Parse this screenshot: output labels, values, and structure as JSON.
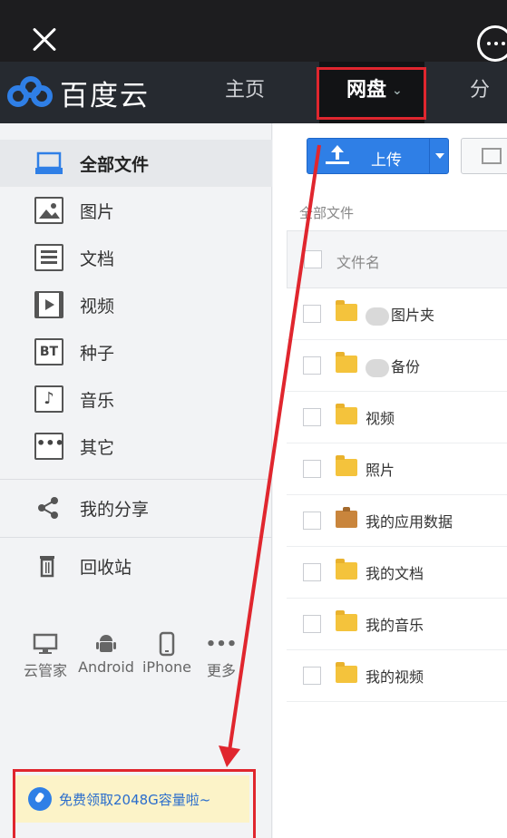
{
  "header": {
    "app_name": "百度云",
    "tabs": [
      {
        "label": "主页"
      },
      {
        "label": "网盘"
      },
      {
        "label": "分享"
      }
    ]
  },
  "sidebar": {
    "items": [
      {
        "label": "全部文件",
        "icon": "all-files-icon"
      },
      {
        "label": "图片",
        "icon": "image-icon"
      },
      {
        "label": "文档",
        "icon": "document-icon"
      },
      {
        "label": "视频",
        "icon": "video-icon"
      },
      {
        "label": "种子",
        "icon": "bt-icon"
      },
      {
        "label": "音乐",
        "icon": "music-icon"
      },
      {
        "label": "其它",
        "icon": "other-icon"
      },
      {
        "label": "我的分享",
        "icon": "share-icon"
      },
      {
        "label": "回收站",
        "icon": "trash-icon"
      }
    ],
    "devices": [
      {
        "label": "云管家",
        "icon": "desktop-icon"
      },
      {
        "label": "Android",
        "icon": "android-icon"
      },
      {
        "label": "iPhone",
        "icon": "iphone-icon"
      },
      {
        "label": "更多",
        "icon": "more-dots-icon"
      }
    ],
    "promo": "免费领取2048G容量啦~"
  },
  "toolbar": {
    "upload_label": "上传"
  },
  "main": {
    "breadcrumb": "全部文件",
    "column_header": "文件名",
    "files": [
      {
        "name": "图片夹",
        "type": "folder"
      },
      {
        "name": "备份",
        "type": "folder"
      },
      {
        "name": "视频",
        "type": "folder"
      },
      {
        "name": "照片",
        "type": "folder"
      },
      {
        "name": "我的应用数据",
        "type": "app-folder"
      },
      {
        "name": "我的文档",
        "type": "folder"
      },
      {
        "name": "我的音乐",
        "type": "folder"
      },
      {
        "name": "我的视频",
        "type": "folder"
      }
    ]
  },
  "colors": {
    "accent": "#2f7fe6",
    "highlight_box": "#e0262e",
    "header_bg": "#262a30",
    "promo_bg": "#fcf3c8"
  }
}
